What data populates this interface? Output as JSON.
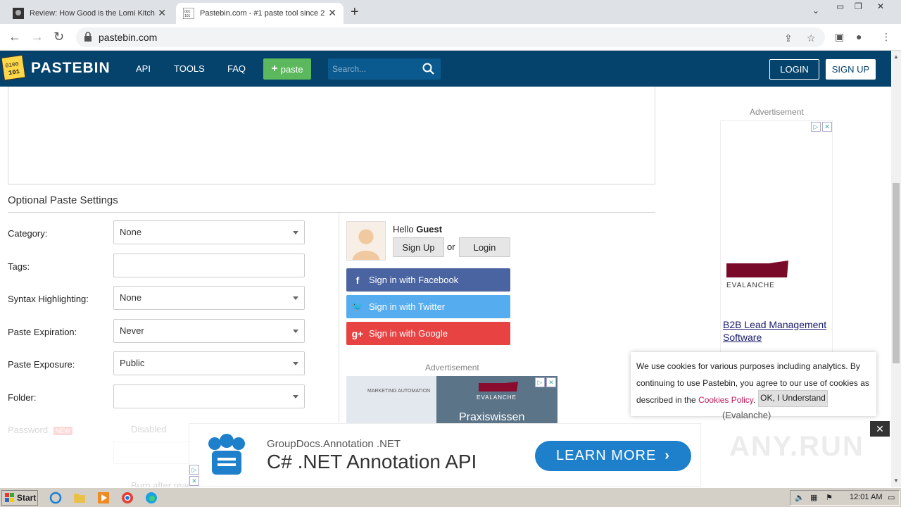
{
  "browser": {
    "tabs": [
      {
        "title": "Review: How Good is the Lomi Kitchen",
        "active": false
      },
      {
        "title": "Pastebin.com - #1 paste tool since 2",
        "active": true
      }
    ],
    "url": "pastebin.com"
  },
  "header": {
    "logo": "PASTEBIN",
    "nav": [
      "API",
      "TOOLS",
      "FAQ"
    ],
    "paste_button": "paste",
    "search_placeholder": "Search...",
    "login": "LOGIN",
    "signup": "SIGN UP"
  },
  "settings": {
    "title": "Optional Paste Settings",
    "fields": [
      {
        "label": "Category:",
        "value": "None"
      },
      {
        "label": "Tags:",
        "value": ""
      },
      {
        "label": "Syntax Highlighting:",
        "value": "None"
      },
      {
        "label": "Paste Expiration:",
        "value": "Never"
      },
      {
        "label": "Paste Exposure:",
        "value": "Public"
      },
      {
        "label": "Folder:",
        "value": ""
      }
    ],
    "password_label": "Password",
    "password_badge": "NEW",
    "password_value": "Disabled",
    "burn_label": "Burn after read"
  },
  "guest": {
    "hello": "Hello",
    "name": "Guest",
    "signup": "Sign Up",
    "or": "or",
    "login": "Login",
    "facebook": "Sign in with Facebook",
    "twitter": "Sign in with Twitter",
    "google": "Sign in with Google"
  },
  "ads": {
    "label": "Advertisement",
    "mid_brand": "EVALANCHE",
    "mid_text": "Praxiswissen",
    "mid_header": "MARKETING AUTOMATION",
    "side_brand": "EVALANCHE",
    "side_title": "B2B Lead Management Software",
    "bottom_sub": "GroupDocs.Annotation .NET",
    "bottom_title": "C# .NET Annotation API",
    "bottom_button": "LEARN MORE"
  },
  "cookie": {
    "text1": "We use cookies for various purposes including analytics. By continuing to use Pastebin, you agree to our use of cookies as described in the ",
    "link": "Cookies Policy",
    "text2": ".",
    "button": "OK, I Understand",
    "tail": "(Evalanche)"
  },
  "watermark": "ANY.RUN",
  "taskbar": {
    "start": "Start",
    "clock": "12:01 AM"
  },
  "colors": {
    "header_bg": "#05436d",
    "paste_green": "#5cb85c",
    "facebook": "#4a63a1",
    "twitter": "#55acee",
    "google": "#e84343",
    "learn_more": "#1e7fcb"
  }
}
